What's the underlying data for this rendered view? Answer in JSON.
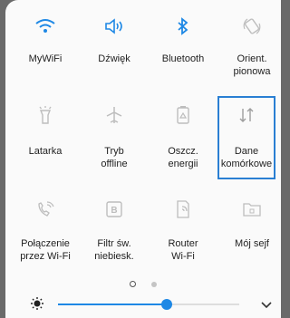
{
  "tiles": [
    {
      "label": "MyWiFi",
      "icon": "wifi-icon",
      "active": true
    },
    {
      "label": "Dźwięk",
      "icon": "speaker-icon",
      "active": true
    },
    {
      "label": "Bluetooth",
      "icon": "bluetooth-icon",
      "active": true
    },
    {
      "label": "Orient.\npionowa",
      "icon": "rotate-icon",
      "active": false
    },
    {
      "label": "Latarka",
      "icon": "flashlight-icon",
      "active": false
    },
    {
      "label": "Tryb\noffline",
      "icon": "airplane-icon",
      "active": false
    },
    {
      "label": "Oszcz.\nenergii",
      "icon": "battery-saver-icon",
      "active": false
    },
    {
      "label": "Dane\nkomórkowe",
      "icon": "mobile-data-icon",
      "active": false
    },
    {
      "label": "Połączenie\nprzez Wi-Fi",
      "icon": "wifi-call-icon",
      "active": false
    },
    {
      "label": "Filtr św.\nniebiesk.",
      "icon": "blue-light-filter-icon",
      "active": false
    },
    {
      "label": "Router\nWi-Fi",
      "icon": "hotspot-icon",
      "active": false
    },
    {
      "label": "Mój sejf",
      "icon": "secure-folder-icon",
      "active": false
    }
  ],
  "pager": {
    "pages": 2,
    "current": 1
  },
  "brightness": {
    "level": 0.6
  },
  "colors": {
    "active": "#1e88e5",
    "inactive": "#bdbdbd",
    "highlight": "#2a7fd3"
  }
}
